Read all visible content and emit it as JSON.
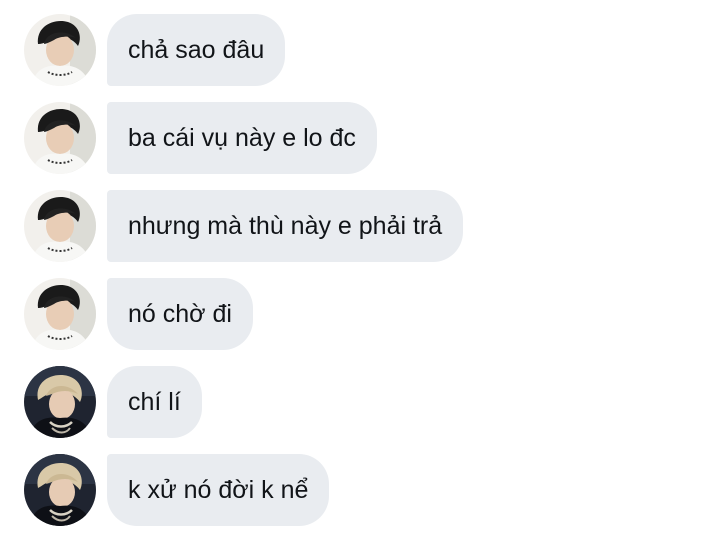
{
  "conversation": {
    "messages": [
      {
        "text": "chả sao đâu",
        "sender_avatar": "avatar-a"
      },
      {
        "text": "ba cái vụ này e lo đc",
        "sender_avatar": "avatar-a"
      },
      {
        "text": "nhưng mà thù này e phải trả",
        "sender_avatar": "avatar-a"
      },
      {
        "text": "nó chờ đi",
        "sender_avatar": "avatar-a"
      },
      {
        "text": "chí lí",
        "sender_avatar": "avatar-b"
      },
      {
        "text": "k xử nó đời k nể",
        "sender_avatar": "avatar-b"
      }
    ]
  },
  "colors": {
    "bubble_background": "#e9ecf0",
    "bubble_text": "#111418",
    "page_background": "#ffffff"
  }
}
